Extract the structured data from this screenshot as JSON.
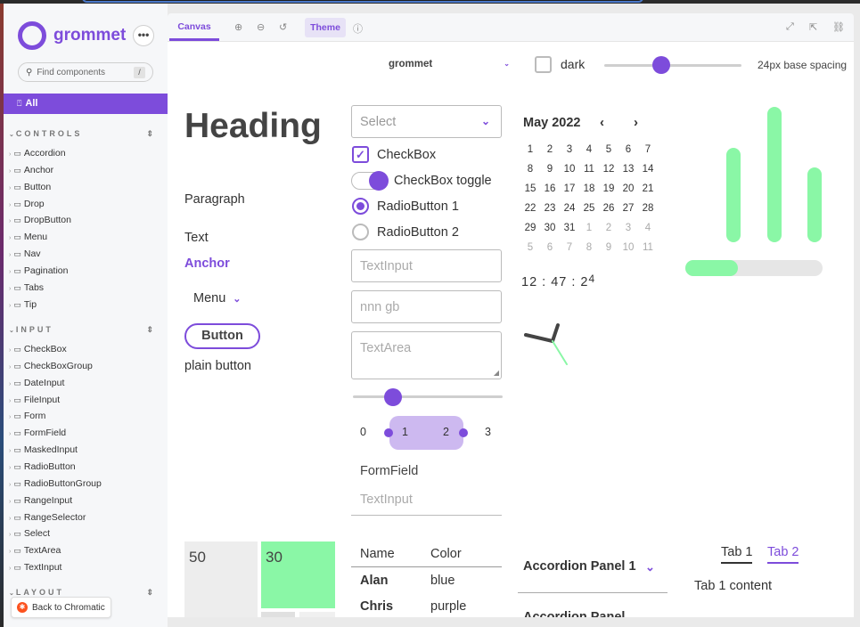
{
  "sidebar": {
    "brand": "grommet",
    "search_placeholder": "Find components",
    "search_shortcut": "/",
    "all_label": "All",
    "groups": [
      {
        "label": "CONTROLS",
        "items": [
          "Accordion",
          "Anchor",
          "Button",
          "Drop",
          "DropButton",
          "Menu",
          "Nav",
          "Pagination",
          "Tabs",
          "Tip"
        ]
      },
      {
        "label": "INPUT",
        "items": [
          "CheckBox",
          "CheckBoxGroup",
          "DateInput",
          "FileInput",
          "Form",
          "FormField",
          "MaskedInput",
          "RadioButton",
          "RadioButtonGroup",
          "RangeInput",
          "RangeSelector",
          "Select",
          "TextArea",
          "TextInput"
        ]
      },
      {
        "label": "LAYOUT",
        "items": []
      }
    ],
    "back_label": "Back to Chromatic"
  },
  "toolbar": {
    "canvas_tab": "Canvas",
    "theme_button": "Theme"
  },
  "controls": {
    "theme_value": "grommet",
    "dark_label": "dark",
    "spacing_label": "24px base spacing",
    "spacing_slider": 0.42
  },
  "col1": {
    "heading": "Heading",
    "paragraph": "Paragraph",
    "text": "Text",
    "anchor": "Anchor",
    "menu": "Menu",
    "button": "Button",
    "plain_button": "plain button"
  },
  "col2": {
    "select_placeholder": "Select",
    "checkbox_label": "CheckBox",
    "toggle_label": "CheckBox toggle",
    "radio1": "RadioButton 1",
    "radio2": "RadioButton 2",
    "textinput_placeholder": "TextInput",
    "masked_placeholder": "nnn gb",
    "textarea_placeholder": "TextArea",
    "range_value": 0.2,
    "range_selector": {
      "min_label": "0",
      "low_label": "1",
      "high_label": "2",
      "max_label": "3"
    },
    "formfield_label": "FormField",
    "formfield_placeholder": "TextInput"
  },
  "calendar": {
    "title": "May 2022",
    "prev": "‹",
    "next": "›",
    "days": [
      [
        "1",
        "2",
        "3",
        "4",
        "5",
        "6",
        "7"
      ],
      [
        "8",
        "9",
        "10",
        "11",
        "12",
        "13",
        "14"
      ],
      [
        "15",
        "16",
        "17",
        "18",
        "19",
        "20",
        "21"
      ],
      [
        "22",
        "23",
        "24",
        "25",
        "26",
        "27",
        "28"
      ],
      [
        "29",
        "30",
        "31",
        "1",
        "2",
        "3",
        "4"
      ],
      [
        "5",
        "6",
        "7",
        "8",
        "9",
        "10",
        "11"
      ]
    ],
    "muted_from_index": 31
  },
  "clock": {
    "main": "12 : 47 : 2",
    "last_digit": "4"
  },
  "chart_data": {
    "type": "bar",
    "values": [
      70,
      100,
      55
    ],
    "ylim": [
      0,
      100
    ]
  },
  "meter": {
    "value": 0.38
  },
  "boxes": {
    "a": "50",
    "b": "30"
  },
  "table": {
    "headers": [
      "Name",
      "Color"
    ],
    "rows": [
      [
        "Alan",
        "blue"
      ],
      [
        "Chris",
        "purple"
      ]
    ]
  },
  "accordion": {
    "panel1": "Accordion Panel 1",
    "panel2": "Accordion Panel"
  },
  "tabs": {
    "tab1": "Tab 1",
    "tab2": "Tab 2",
    "content": "Tab 1 content"
  },
  "colors": {
    "brand": "#7d4cdb",
    "accent": "#8af7a6"
  }
}
